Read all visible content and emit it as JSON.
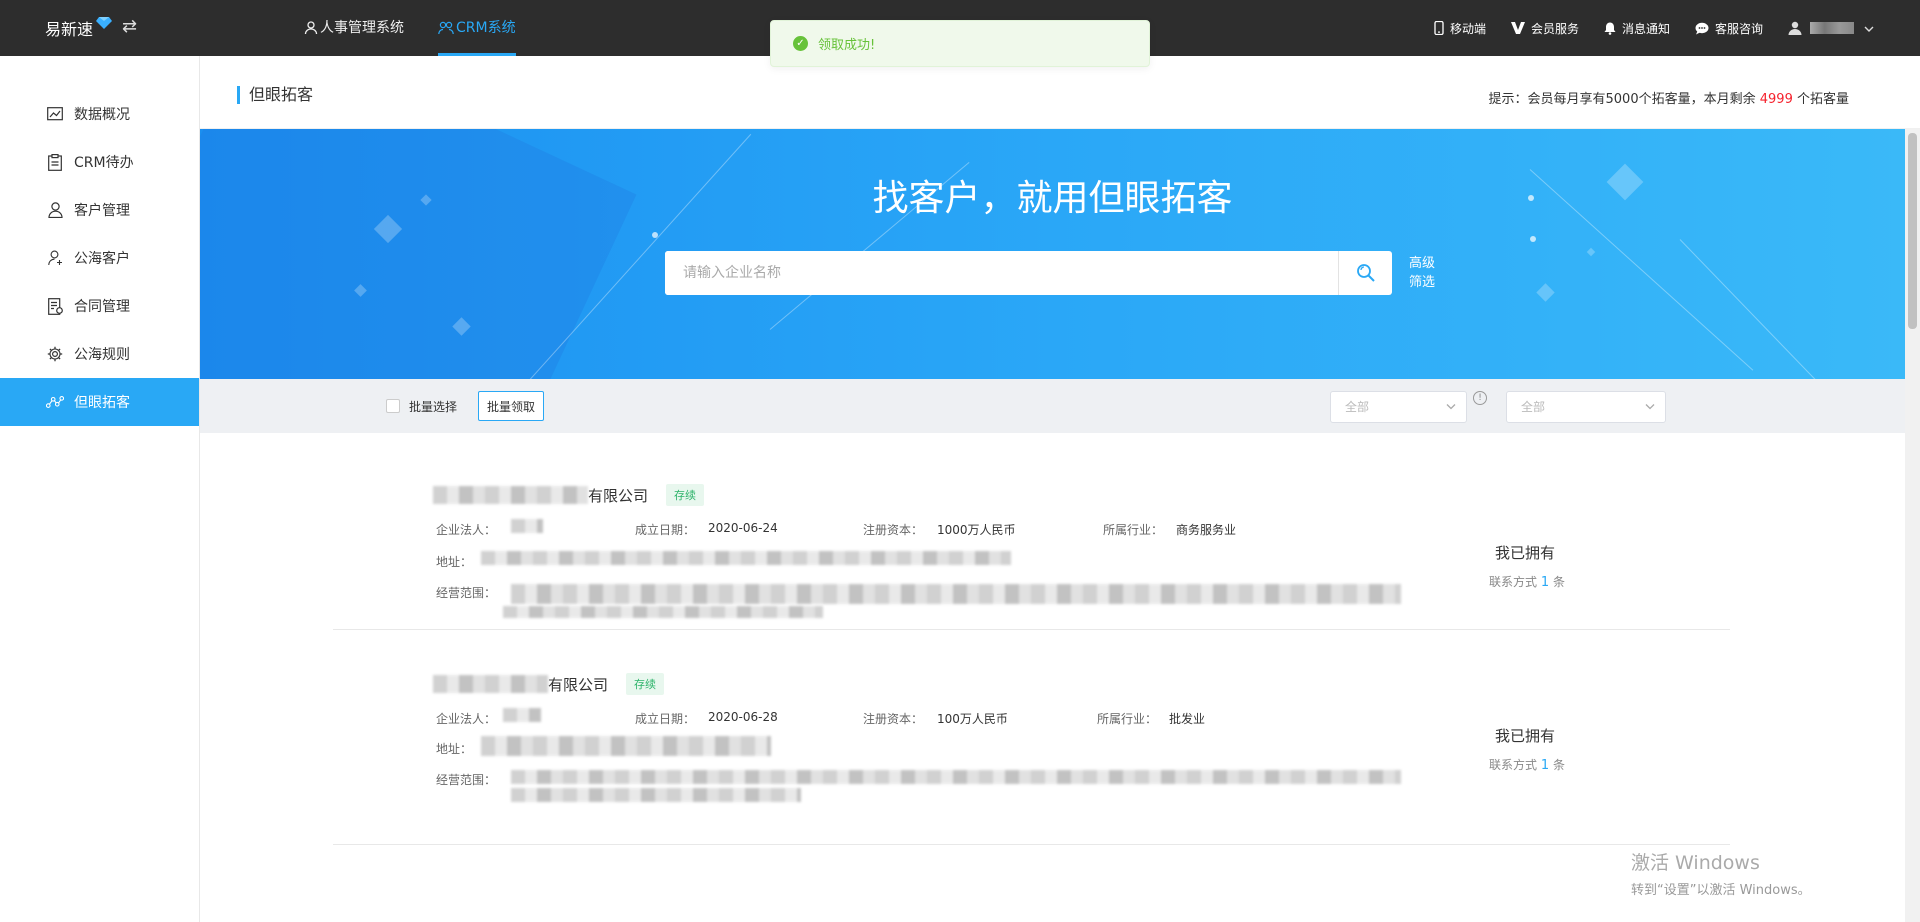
{
  "topbar": {
    "brand": "易新速",
    "nav": [
      {
        "label": "人事管理系统",
        "active": false
      },
      {
        "label": "CRM系统",
        "active": true
      }
    ],
    "right": [
      {
        "label": "移动端",
        "icon": "phone-icon"
      },
      {
        "label": "会员服务",
        "icon": "vip-icon"
      },
      {
        "label": "消息通知",
        "icon": "bell-icon"
      },
      {
        "label": "客服咨询",
        "icon": "chat-icon"
      }
    ]
  },
  "toast": {
    "message": "领取成功!",
    "color": "#67c23a"
  },
  "sidebar": {
    "items": [
      {
        "label": "数据概况",
        "icon": "chart-icon"
      },
      {
        "label": "CRM待办",
        "icon": "clipboard-icon"
      },
      {
        "label": "客户管理",
        "icon": "user-icon"
      },
      {
        "label": "公海客户",
        "icon": "user-outline-icon"
      },
      {
        "label": "合同管理",
        "icon": "contract-icon"
      },
      {
        "label": "公海规则",
        "icon": "gear-icon"
      },
      {
        "label": "但眼拓客",
        "icon": "network-icon",
        "active": true
      }
    ]
  },
  "page": {
    "title": "但眼拓客",
    "hint_prefix": "提示：会员每月享有5000个拓客量，本月剩余",
    "hint_num": "4999",
    "hint_suffix": "个拓客量"
  },
  "banner": {
    "title": "找客户，就用但眼拓客",
    "search_placeholder": "请输入企业名称",
    "advanced_filter": "高级筛选"
  },
  "filter": {
    "batch_select": "批量选择",
    "batch_claim": "批量领取",
    "select1": "全部",
    "select2": "全部"
  },
  "labels": {
    "legal": "企业法人：",
    "founded": "成立日期：",
    "capital": "注册资本：",
    "industry": "所属行业：",
    "address": "地址：",
    "scope": "经营范围：",
    "owned": "我已拥有",
    "contact_prefix": "联系方式",
    "contact_suffix": "条"
  },
  "companies": [
    {
      "name_suffix": "有限公司",
      "tag": "存续",
      "founded": "2020-06-24",
      "capital": "1000万人民币",
      "industry": "商务服务业",
      "contacts": "1"
    },
    {
      "name_suffix": "有限公司",
      "tag": "存续",
      "founded": "2020-06-28",
      "capital": "100万人民币",
      "industry": "批发业",
      "contacts": "1"
    }
  ],
  "watermark": {
    "line1": "激活 Windows",
    "line2": "转到“设置”以激活 Windows。"
  },
  "colors": {
    "accent": "#29a8f5",
    "topbar": "#2d2d2d",
    "success": "#67c23a",
    "danger": "#f5222d"
  }
}
